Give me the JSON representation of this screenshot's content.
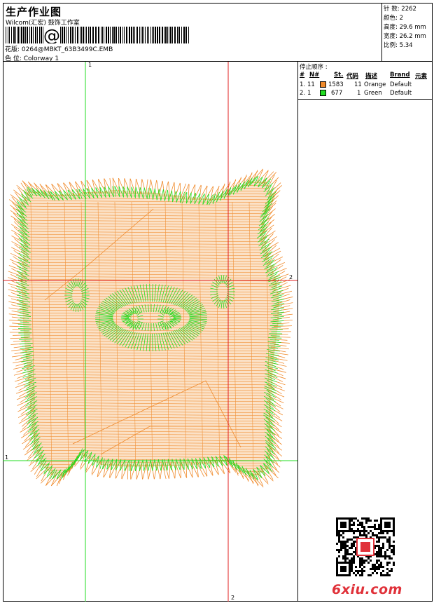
{
  "header": {
    "title": "生产作业图",
    "company": "Wilcom(汇宏) 鼓饰工作室",
    "design_label": "花版: 0264@MBKT_63B3499C.EMB",
    "colorway_label": "色 位: Colorway 1"
  },
  "stats": [
    {
      "label": "针 数:",
      "value": "2262"
    },
    {
      "label": "颜色:",
      "value": "2"
    },
    {
      "label": "高度:",
      "value": "29.6 mm"
    },
    {
      "label": "宽度:",
      "value": "26.2 mm"
    },
    {
      "label": "比例:",
      "value": "5.34"
    }
  ],
  "stop_sequence": {
    "title": "停止顺序 :",
    "headers": [
      "#",
      "N#",
      "St.",
      "代码",
      "描述",
      "Brand",
      "元素"
    ],
    "rows": [
      {
        "index": "1.",
        "needle": "11",
        "color": "#f08a2b",
        "stitches": "1583",
        "code": "11",
        "description": "Orange",
        "brand": "Default"
      },
      {
        "index": "2.",
        "needle": "1",
        "color": "#22dd22",
        "stitches": "677",
        "code": "1",
        "description": "Green",
        "brand": "Default"
      }
    ]
  },
  "guides": {
    "green_top_label": "1",
    "green_left_label": "1",
    "red_right_label": "2",
    "red_bottom_label": "2"
  },
  "watermark": "6xiu.com",
  "colors": {
    "orange": "#f08a2b",
    "green": "#22dd22",
    "red": "#e02020"
  }
}
